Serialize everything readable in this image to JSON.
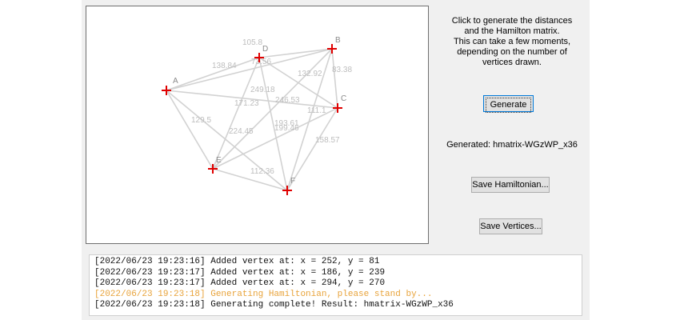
{
  "instructions": [
    "Click to generate the distances",
    "and the Hamilton matrix.",
    "This can take a few moments,",
    "depending on the number of",
    "vertices drawn."
  ],
  "buttons": {
    "generate": "Generate",
    "save_hamiltonian": "Save Hamiltonian...",
    "save_vertices": "Save Vertices..."
  },
  "generated_label": "Generated: hmatrix-WGzWP_x36",
  "vertex_labels": [
    "A",
    "B",
    "C",
    "D",
    "E",
    "F"
  ],
  "edge_labels": [
    "105.8",
    "138.84",
    "83.38",
    "132.92",
    "249.18",
    "171.23",
    "246.53",
    "111.1",
    "129.5",
    "193.61",
    "224.45",
    "199.46",
    "158.57",
    "112.36",
    "73.56"
  ],
  "colors": {
    "vertex": "#e00000",
    "edge": "#d2d2d2",
    "log_warning": "#e8a33a"
  },
  "log": [
    {
      "text": "[2022/06/23 19:23:16] Added vertex at: x = 252, y = 81",
      "level": "info"
    },
    {
      "text": "[2022/06/23 19:23:17] Added vertex at: x = 186, y = 239",
      "level": "info"
    },
    {
      "text": "[2022/06/23 19:23:17] Added vertex at: x = 294, y = 270",
      "level": "info"
    },
    {
      "text": "[2022/06/23 19:23:18] Generating Hamiltonian, please stand by...",
      "level": "warning"
    },
    {
      "text": "[2022/06/23 19:23:18] Generating complete! Result: hmatrix-WGzWP_x36",
      "level": "info"
    }
  ]
}
